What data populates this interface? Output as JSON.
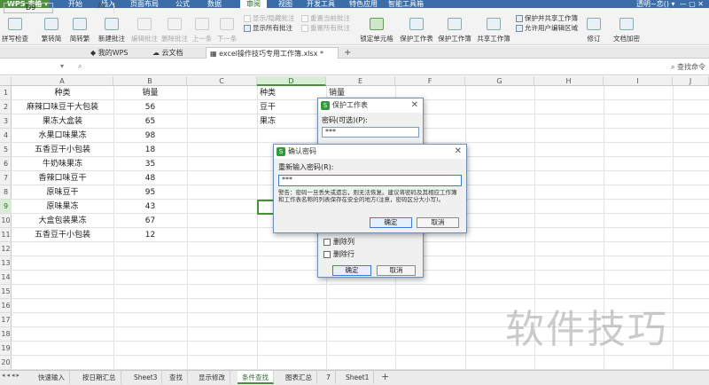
{
  "app": {
    "name": "WPS 表格",
    "user": "透明~恋()"
  },
  "ribbon_tabs": [
    "开始",
    "插入",
    "页面布局",
    "公式",
    "数据",
    "审阅",
    "视图",
    "开发工具",
    "特色应用",
    "智能工具箱"
  ],
  "active_ribbon_tab": "审阅",
  "ribbon": {
    "spell_check": "拼写检查",
    "abc": "ABC",
    "to_traditional": "繁转简",
    "to_simplified": "简转繁",
    "new_comment": "新建批注",
    "edit_comment": "编辑批注",
    "delete_comment": "删除批注",
    "prev": "上一条",
    "next": "下一条",
    "show_hide_comment": "显示/隐藏批注",
    "reset_current_comment": "重置当前批注",
    "show_all_comments": "显示所有批注",
    "reset_all_comments": "重置所有批注",
    "lock_cell": "锁定单元格",
    "protect_sheet": "保护工作表",
    "protect_workbook": "保护工作簿",
    "share_workbook": "共享工作簿",
    "protect_share_workbook": "保护并共享工作簿",
    "allow_edit_ranges": "允许用户编辑区域",
    "revise": "修订",
    "doc_encrypt": "文档加密"
  },
  "doc_tabs": [
    "我的WPS",
    "云文档",
    "excel操作技巧专用工作簿.xlsx *"
  ],
  "formula_bar": {
    "cell_ref": "D9",
    "fx": "fx",
    "search": "查找命令"
  },
  "columns": [
    "A",
    "B",
    "C",
    "D",
    "E",
    "F",
    "G",
    "H",
    "I",
    "J"
  ],
  "rows": [
    "1",
    "2",
    "3",
    "4",
    "5",
    "6",
    "7",
    "8",
    "9",
    "10",
    "11",
    "12",
    "13",
    "14",
    "15",
    "16",
    "17",
    "18",
    "19",
    "20"
  ],
  "table": {
    "headers": {
      "kind": "种类",
      "sales": "销量"
    },
    "items": [
      {
        "kind": "麻辣口味豆干大包装",
        "sales": "56"
      },
      {
        "kind": "果冻大盒装",
        "sales": "65"
      },
      {
        "kind": "水果口味果冻",
        "sales": "98"
      },
      {
        "kind": "五香豆干小包装",
        "sales": "18"
      },
      {
        "kind": "牛奶味果冻",
        "sales": "35"
      },
      {
        "kind": "香辣口味豆干",
        "sales": "48"
      },
      {
        "kind": "原味豆干",
        "sales": "95"
      },
      {
        "kind": "原味果冻",
        "sales": "43"
      },
      {
        "kind": "大盒包装果冻",
        "sales": "67"
      },
      {
        "kind": "五香豆干小包装",
        "sales": "12"
      }
    ]
  },
  "lookup": {
    "kind_header": "种类",
    "sales_header": "销量",
    "items": [
      "豆干",
      "果冻"
    ]
  },
  "protect_dialog": {
    "title": "保护工作表",
    "password_label": "密码(可选)(P):",
    "password_value": "***",
    "options": [
      "删除列",
      "删除行"
    ],
    "ok": "确定",
    "cancel": "取消"
  },
  "confirm_dialog": {
    "title": "确认密码",
    "label": "重新输入密码(R):",
    "password_value": "***",
    "warning": "警告：密码一旦丢失或遗忘，则无法恢复。建议将密码及其相应工作簿和工作表名称的列表保存在安全的地方(注意，密码区分大小写)。",
    "ok": "确定",
    "cancel": "取消"
  },
  "sheet_tabs": [
    "快速输入",
    "按日期汇总",
    "Sheet3",
    "查找",
    "显示修改",
    "条件查找",
    "图表汇总",
    "7",
    "Sheet1"
  ],
  "active_sheet": "条件查找",
  "watermark": "软件技巧",
  "colors": {
    "accent": "#4a8f3a",
    "title_bar": "#3b6ea8"
  }
}
